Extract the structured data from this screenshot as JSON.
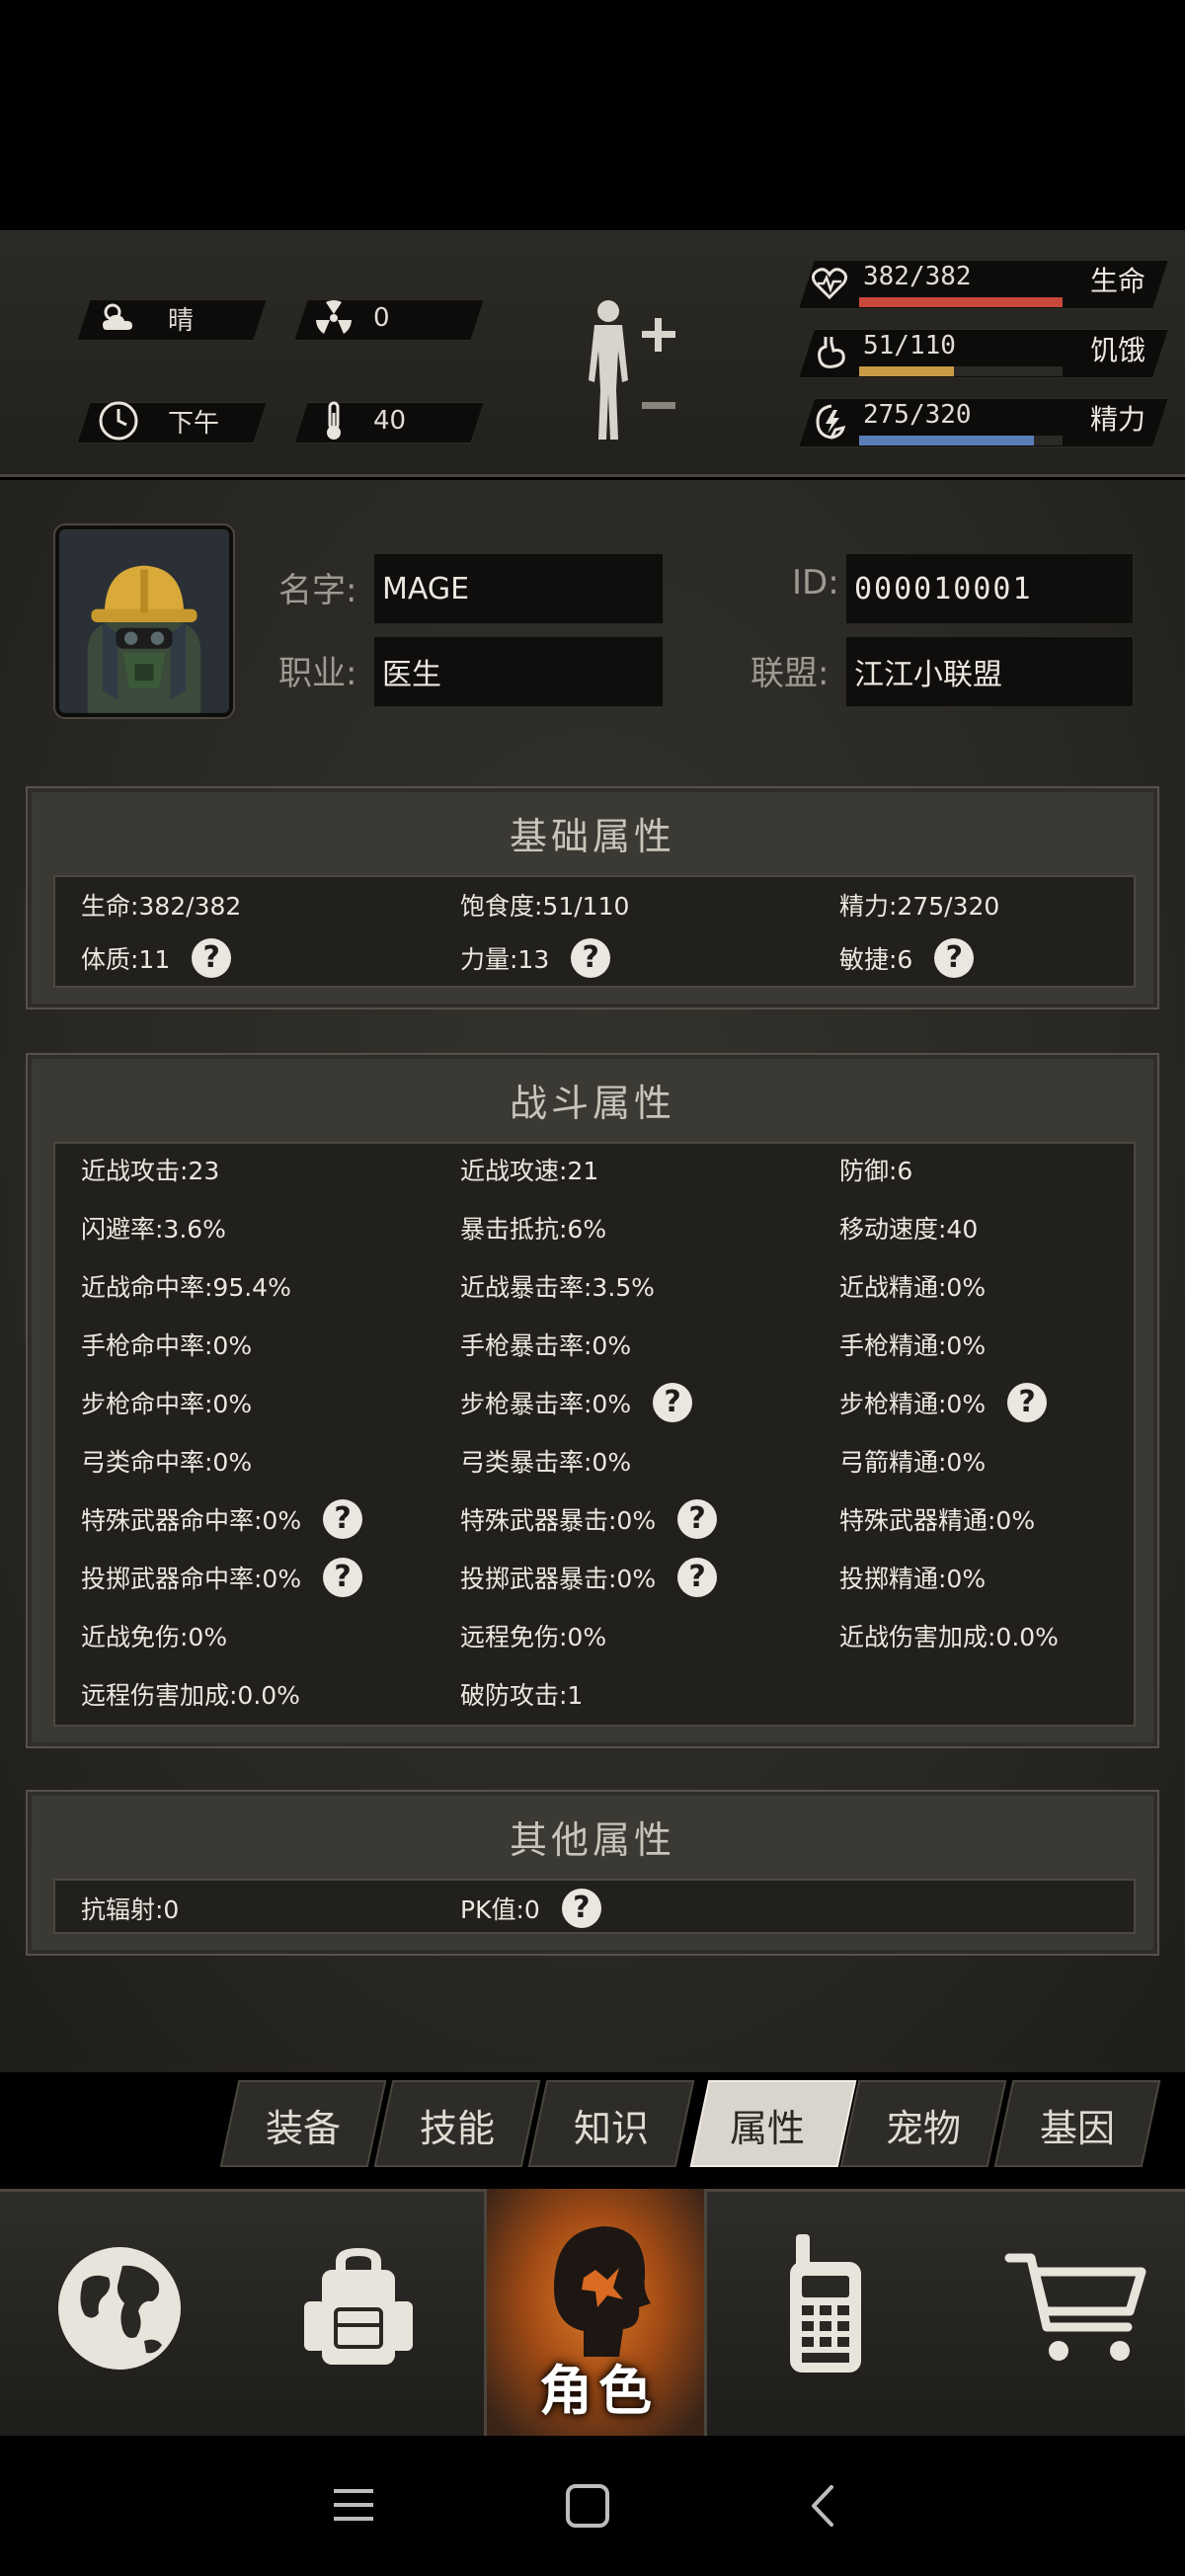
{
  "status": {
    "weather_label": "晴",
    "radiation_value": "0",
    "time_label": "下午",
    "temperature_value": "40",
    "life": {
      "text": "382/382",
      "label": "生命",
      "fraction": 1.0,
      "color": "#c9483a"
    },
    "hunger": {
      "text": "51/110",
      "label": "饥饿",
      "fraction": 0.4636,
      "color": "#c99a45"
    },
    "energy": {
      "text": "275/320",
      "label": "精力",
      "fraction": 0.859,
      "color": "#5a7fb8"
    }
  },
  "profile": {
    "name_label": "名字:",
    "name_value": "MAGE",
    "id_label": "ID:",
    "id_value": "000010001",
    "job_label": "职业:",
    "job_value": "医生",
    "alliance_label": "联盟:",
    "alliance_value": "江江小联盟"
  },
  "basic": {
    "title": "基础属性",
    "rows": [
      [
        "生命:382/382",
        "饱食度:51/110",
        "精力:275/320"
      ],
      [
        "体质:11",
        "力量:13",
        "敏捷:6"
      ]
    ]
  },
  "combat": {
    "title": "战斗属性",
    "rows": [
      [
        "近战攻击:23",
        "近战攻速:21",
        "防御:6"
      ],
      [
        "闪避率:3.6%",
        "暴击抵抗:6%",
        "移动速度:40"
      ],
      [
        "近战命中率:95.4%",
        "近战暴击率:3.5%",
        "近战精通:0%"
      ],
      [
        "手枪命中率:0%",
        "手枪暴击率:0%",
        "手枪精通:0%"
      ],
      [
        "步枪命中率:0%",
        "步枪暴击率:0%",
        "步枪精通:0%"
      ],
      [
        "弓类命中率:0%",
        "弓类暴击率:0%",
        "弓箭精通:0%"
      ],
      [
        "特殊武器命中率:0%",
        "特殊武器暴击:0%",
        "特殊武器精通:0%"
      ],
      [
        "投掷武器命中率:0%",
        "投掷武器暴击:0%",
        "投掷精通:0%"
      ],
      [
        "近战免伤:0%",
        "远程免伤:0%",
        "近战伤害加成:0.0%"
      ],
      [
        "远程伤害加成:0.0%",
        "破防攻击:1",
        ""
      ]
    ]
  },
  "other": {
    "title": "其他属性",
    "rows": [
      [
        "抗辐射:0",
        "PK值:0"
      ]
    ]
  },
  "help_glyph": "?",
  "tabs": [
    "装备",
    "技能",
    "知识",
    "属性",
    "宠物",
    "基因"
  ],
  "active_tab": "属性",
  "bottom_nav": {
    "character_label": "角色"
  },
  "icons": [
    "weather-sun-cloud-icon",
    "radiation-icon",
    "clock-icon",
    "thermometer-icon",
    "body-plus-minus-icon",
    "heart-icon",
    "stomach-icon",
    "energy-icon",
    "globe-icon",
    "backpack-icon",
    "character-head-icon",
    "walkie-talkie-icon",
    "cart-icon",
    "menu-icon",
    "home-icon",
    "back-icon"
  ]
}
